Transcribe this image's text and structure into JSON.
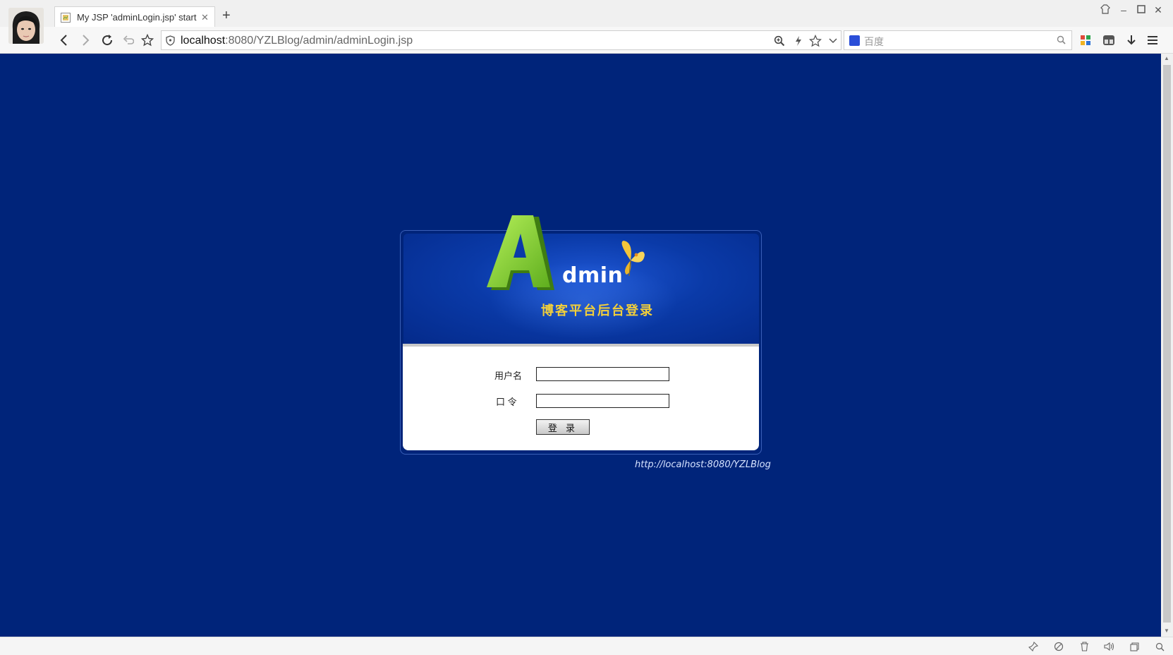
{
  "browser": {
    "tab_title": "My JSP 'adminLogin.jsp' start",
    "url_host": "localhost",
    "url_rest": ":8080/YZLBlog/admin/adminLogin.jsp",
    "search_placeholder": "百度"
  },
  "login": {
    "logo_letter": "A",
    "logo_rest": "dmin",
    "subtitle": "博客平台后台登录",
    "username_label": "用户名",
    "password_label": "口 令",
    "username_value": "",
    "password_value": "",
    "submit_label": "登 录",
    "footer_link": "http://localhost:8080/YZLBlog"
  },
  "colors": {
    "page_background": "#00247a",
    "subtitle_text": "#f2cf3a",
    "logo_green": "#8fdc3a"
  }
}
